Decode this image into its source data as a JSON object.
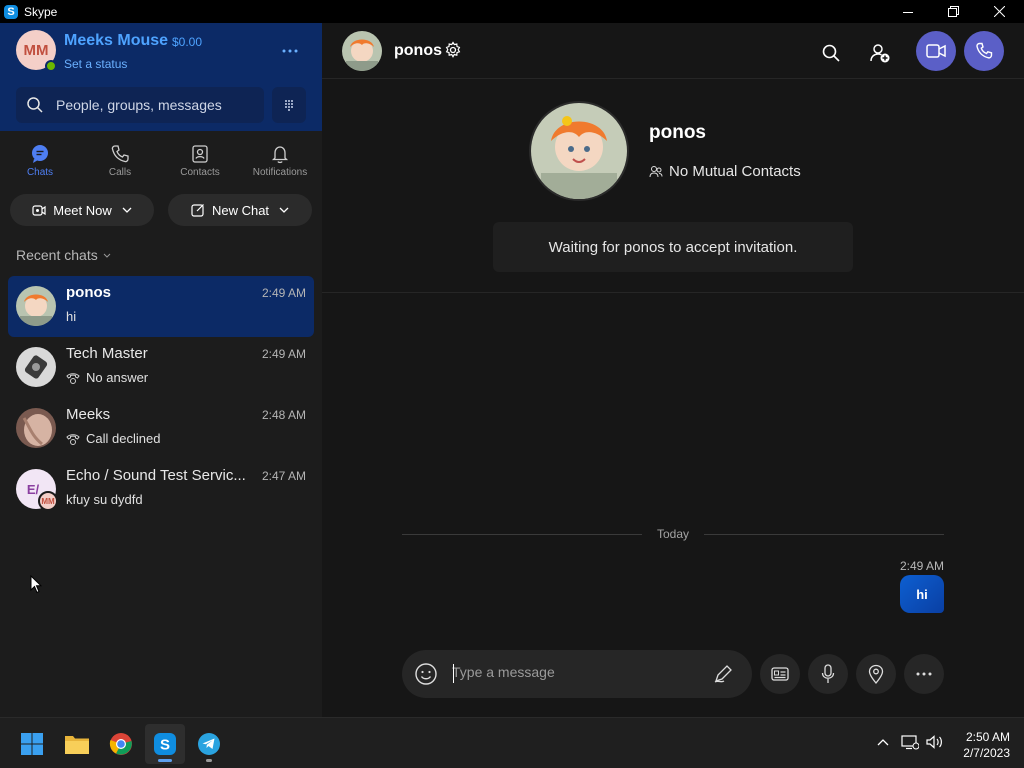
{
  "window": {
    "title": "Skype",
    "app_icon_letter": "S"
  },
  "profile": {
    "initials": "MM",
    "name": "Meeks Mouse",
    "credit": "$0.00",
    "status": "Set a status"
  },
  "search": {
    "placeholder": "People, groups, messages"
  },
  "nav_tabs": [
    {
      "label": "Chats",
      "icon": "chat-icon",
      "active": true
    },
    {
      "label": "Calls",
      "icon": "phone-icon",
      "active": false
    },
    {
      "label": "Contacts",
      "icon": "contacts-icon",
      "active": false
    },
    {
      "label": "Notifications",
      "icon": "bell-icon",
      "active": false
    }
  ],
  "actions": {
    "meet_now": "Meet Now",
    "new_chat": "New Chat"
  },
  "recent": {
    "header": "Recent chats"
  },
  "chats": [
    {
      "name": "ponos",
      "time": "2:49 AM",
      "preview": "hi",
      "active": true,
      "call_icon": false
    },
    {
      "name": "Tech Master",
      "time": "2:49 AM",
      "preview": "No answer",
      "active": false,
      "call_icon": true
    },
    {
      "name": "Meeks",
      "time": "2:48 AM",
      "preview": "Call declined",
      "active": false,
      "call_icon": true
    },
    {
      "name": "Echo / Sound Test Servic...",
      "time": "2:47 AM",
      "preview": "kfuy su dydfd",
      "active": false,
      "call_icon": false,
      "avatar_initials": "E/",
      "badge_initials": "MM"
    }
  ],
  "conversation": {
    "name": "ponos",
    "mutual": "No Mutual Contacts",
    "waiting": "Waiting for ponos to accept invitation.",
    "day_divider": "Today",
    "messages": [
      {
        "time": "2:49 AM",
        "text": "hi",
        "outgoing": true
      }
    ]
  },
  "composer": {
    "placeholder": "Type a message"
  },
  "clock": {
    "time": "2:50 AM",
    "date": "2/7/2023"
  },
  "colors": {
    "accent": "#5b5fc7",
    "sidebar_header": "#0c2a66",
    "bubble": "#0d5fd1",
    "presence": "#6bb700"
  }
}
